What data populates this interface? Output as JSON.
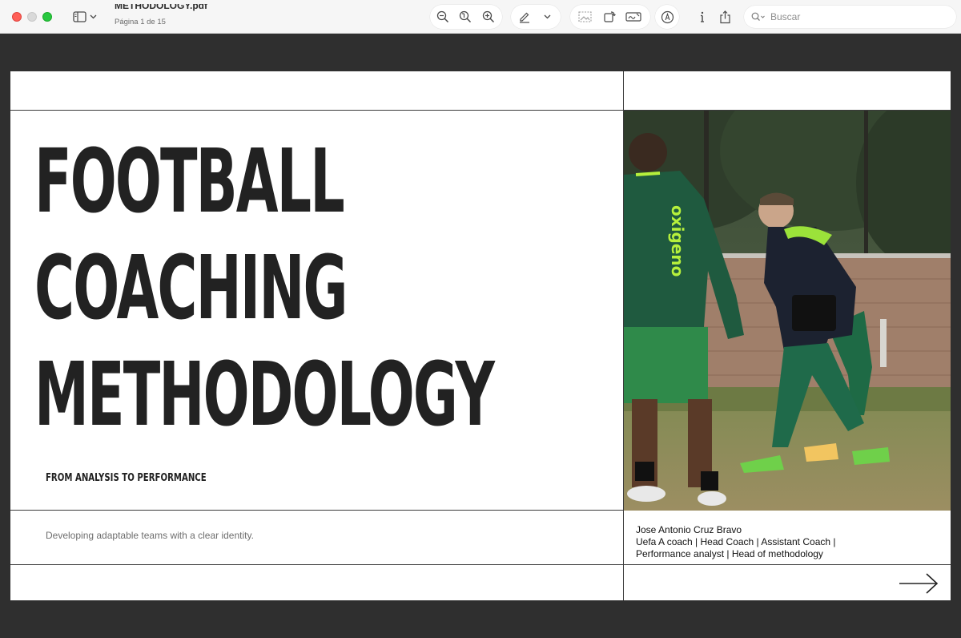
{
  "app": {
    "document_title": "METHODOLOGY.pdf",
    "page_indicator": "Página 1 de 15",
    "search_placeholder": "Buscar"
  },
  "toolbar_icons": [
    "sidebar-icon",
    "chevron-down-icon",
    "zoom-out-icon",
    "zoom-fit-icon",
    "zoom-in-icon",
    "highlight-pen-icon",
    "chevron-down-icon",
    "image-select-icon",
    "rotate-icon",
    "signature-icon",
    "markup-icon",
    "info-icon",
    "share-icon",
    "search-icon"
  ],
  "slide": {
    "title_lines": [
      "FOOTBALL",
      "COACHING",
      "METHODOLOGY"
    ],
    "tagline": "FROM ANALYSIS TO PERFORMANCE",
    "subtitle": "Developing adaptable teams with a clear identity.",
    "author_name": "Jose Antonio Cruz Bravo",
    "author_roles_line1": "Uefa A coach | Head Coach | Assistant Coach |",
    "author_roles_line2": "Performance analyst | Head of methodology",
    "shirt_text": "oxigeno"
  },
  "colors": {
    "page_bg": "#2f2f2f",
    "slide_bg": "#ffffff",
    "text_dark": "#222222",
    "kit_green": "#1f5a3f",
    "accent_neon": "#b6f03c"
  }
}
